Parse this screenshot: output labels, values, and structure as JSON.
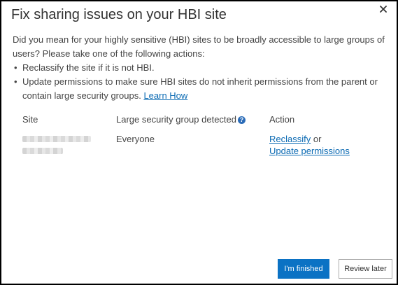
{
  "dialog": {
    "title": "Fix sharing issues on your HBI site",
    "close_icon": "close-icon",
    "intro": "Did you mean for your highly sensitive (HBI) sites to be broadly accessible to large groups of users? Please take one of the following actions:",
    "bullets": [
      {
        "text": "Reclassify the site if it is not HBI."
      },
      {
        "text": "Update permissions to make sure HBI sites do not inherit permissions from the parent or contain large security groups.",
        "link": "Learn How"
      }
    ],
    "table": {
      "headers": {
        "site": "Site",
        "group": "Large security group detected",
        "action": "Action"
      },
      "help_icon": "help-icon",
      "rows": [
        {
          "site": "",
          "group": "Everyone",
          "action_reclassify": "Reclassify",
          "action_or": "or",
          "action_update": "Update permissions"
        }
      ]
    },
    "buttons": {
      "finished": "I'm finished",
      "review_later": "Review later"
    },
    "colors": {
      "link": "#0b6ab3",
      "primary_button": "#0b72c4",
      "help_icon": "#2b6cb8"
    }
  }
}
